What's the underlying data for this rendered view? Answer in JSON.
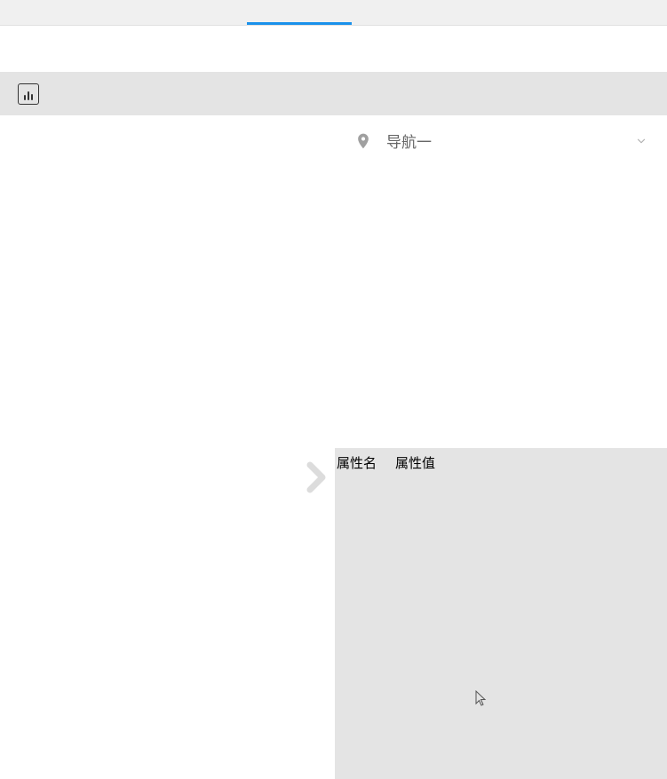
{
  "nav": {
    "items": [
      {
        "label": "导航一"
      }
    ]
  },
  "props": {
    "header": {
      "name": "属性名",
      "value": "属性值"
    }
  },
  "colors": {
    "accent": "#1a91eb",
    "toolbar_bg": "#e4e4e4",
    "text_muted": "#666"
  }
}
